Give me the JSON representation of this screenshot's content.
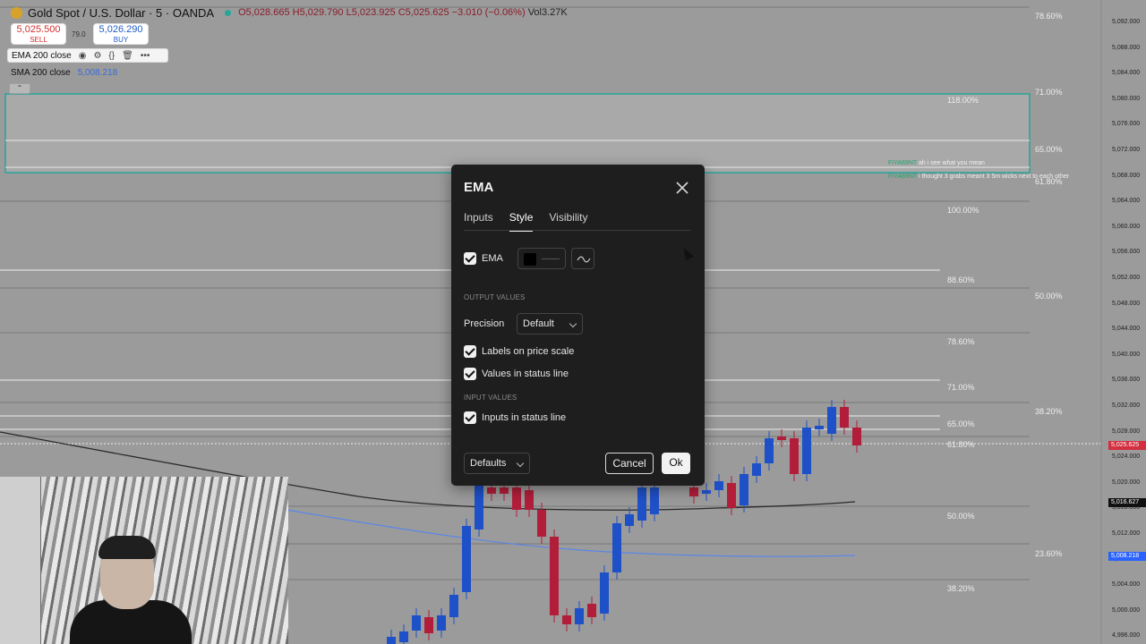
{
  "header": {
    "symbol": "Gold Spot / U.S. Dollar · 5 · OANDA",
    "open": "O5,028.665",
    "high": "H5,029.790",
    "low": "L5,023.925",
    "close": "C5,025.625",
    "change": "−3.010 (−0.06%)",
    "volume": "Vol3.27K"
  },
  "trade": {
    "sell_price": "5,025.500",
    "sell_label": "SELL",
    "spread": "79.0",
    "buy_price": "5,026.290",
    "buy_label": "BUY"
  },
  "indicators": {
    "ema_label": "EMA 200 close",
    "sma_label": "SMA 200 close",
    "sma_value": "5,008.218"
  },
  "price_scale": {
    "labels": [
      "5,092.000",
      "5,088.000",
      "5,084.000",
      "5,080.000",
      "5,076.000",
      "5,072.000",
      "5,068.000",
      "5,064.000",
      "5,060.000",
      "5,056.000",
      "5,052.000",
      "5,048.000",
      "5,044.000",
      "5,040.000",
      "5,036.000",
      "5,032.000",
      "5,028.000",
      "5,024.000",
      "5,020.000",
      "5,016.000",
      "5,012.000",
      "5,008.000",
      "5,004.000",
      "5,000.000",
      "4,996.000"
    ],
    "tag_current": "5,025.625",
    "tag_ema": "5,016.627",
    "tag_sma": "5,008.218",
    "colors": {
      "current": "#d32f3f",
      "ema": "#111111",
      "sma": "#2962ff"
    }
  },
  "fib_levels": {
    "a": [
      "118.00%",
      "100.00%",
      "88.60%",
      "78.60%",
      "71.00%",
      "65.00%",
      "61.80%",
      "50.00%",
      "38.20%"
    ],
    "b": [
      "78.60%",
      "71.00%",
      "65.00%",
      "61.80%",
      "50.00%",
      "38.20%",
      "23.60%"
    ]
  },
  "chat": [
    {
      "user": "FIYA69NT",
      "text": "ah i see what you mean"
    },
    {
      "user": "FIYA69NT",
      "text": "i thought 3 grabs meant 3 5m wicks next to each other"
    }
  ],
  "dialog": {
    "title": "EMA",
    "tabs": [
      "Inputs",
      "Style",
      "Visibility"
    ],
    "active_tab": "Style",
    "ema_checkbox_label": "EMA",
    "output_values_heading": "OUTPUT VALUES",
    "precision_label": "Precision",
    "precision_value": "Default",
    "labels_on_price_scale": "Labels on price scale",
    "values_in_status_line": "Values in status line",
    "input_values_heading": "INPUT VALUES",
    "inputs_in_status_line": "Inputs in status line",
    "defaults_label": "Defaults",
    "cancel_label": "Cancel",
    "ok_label": "Ok",
    "line_color": "#000000"
  },
  "colors": {
    "bull": "#1e50c8",
    "bear": "#b21e3a",
    "zone_border": "#26a69a"
  }
}
